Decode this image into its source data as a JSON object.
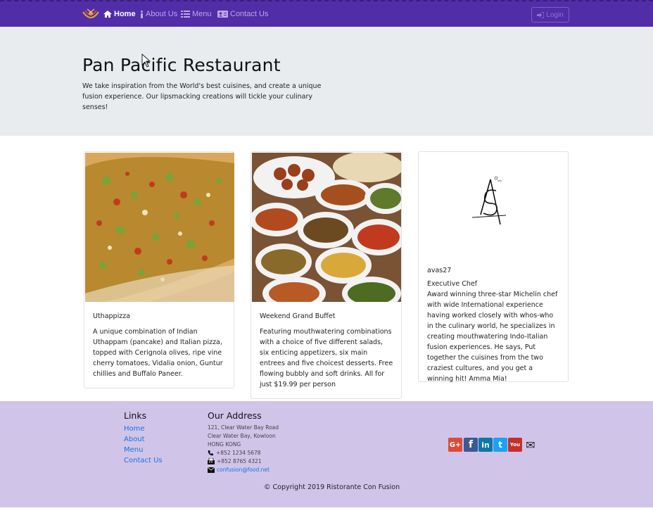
{
  "colors": {
    "navbar": "#512da8",
    "jumbotron": "#e9ecef",
    "footer": "#d1c4e9",
    "link": "#1a73d9"
  },
  "nav": {
    "brand_icon": "logo-icon",
    "items": [
      {
        "label": "Home",
        "icon": "home-icon",
        "active": true
      },
      {
        "label": "About Us",
        "icon": "info-icon"
      },
      {
        "label": "Menu",
        "icon": "list-icon"
      },
      {
        "label": "Contact Us",
        "icon": "address-card-icon"
      }
    ],
    "login_label": "Login",
    "login_icon": "sign-in-icon"
  },
  "jumbotron": {
    "title": "Pan Pacific Restaurant",
    "description": "We take inspiration from the World's best cuisines, and create a unique fusion experience. Our lipsmacking creations will tickle your culinary senses!"
  },
  "cards": [
    {
      "title": "Uthappizza",
      "text": "A unique combination of Indian Uthappam (pancake) and Italian pizza, topped with Cerignola olives, ripe vine cherry tomatoes, Vidalia onion, Guntur chillies and Buffalo Paneer."
    },
    {
      "title": "Weekend Grand Buffet",
      "text": "Featuring mouthwatering combinations with a choice of five different salads, six enticing appetizers, six main entrees and five choicest desserts. Free flowing bubbly and soft drinks. All for just $19.99 per person"
    },
    {
      "name": "avas27",
      "designation": "Executive Chef",
      "text": "Award winning three-star Michelin chef with wide International experience having worked closely with whos-who in the culinary world, he specializes in creating mouthwatering Indo-Italian fusion experiences. He says, Put together the cuisines from the two craziest cultures, and you get a winning hit! Amma Mia!"
    }
  ],
  "footer": {
    "links_heading": "Links",
    "links": [
      "Home",
      "About",
      "Menu",
      "Contact Us"
    ],
    "address_heading": "Our Address",
    "address_lines": [
      "121, Clear Water Bay Road",
      "Clear Water Bay, Kowloon",
      "HONG KONG"
    ],
    "phone": "+852 1234 5678",
    "fax": "+852 8765 4321",
    "email": "confusion@food.net",
    "social": [
      {
        "icon": "google-plus-icon",
        "glyph": "G+",
        "color": "#dd4b39"
      },
      {
        "icon": "facebook-icon",
        "glyph": "f",
        "color": "#3b5998"
      },
      {
        "icon": "linkedin-icon",
        "glyph": "in",
        "color": "#0e76a8"
      },
      {
        "icon": "twitter-icon",
        "glyph": "t",
        "color": "#1da1f2"
      },
      {
        "icon": "youtube-icon",
        "glyph": "You",
        "color": "#c4302b"
      },
      {
        "icon": "mail-icon",
        "glyph": "✉",
        "color": "transparent"
      }
    ],
    "copyright": "© Copyright 2019 Ristorante Con Fusion"
  }
}
